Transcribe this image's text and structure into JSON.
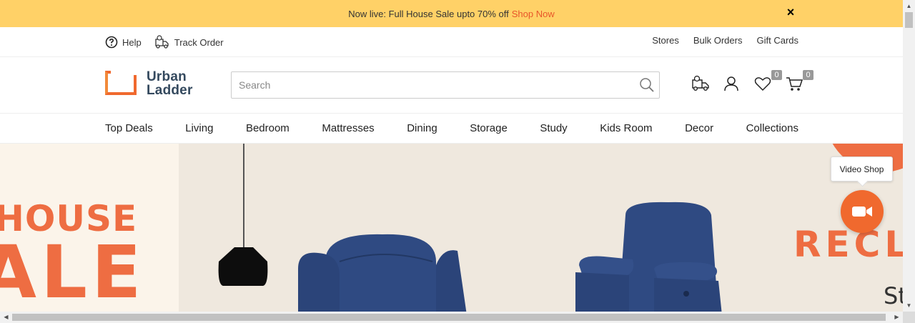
{
  "announcement": {
    "text": "Now live: Full House Sale upto 70% off",
    "link": "Shop Now",
    "close": "×"
  },
  "utility": {
    "help": "Help",
    "track_order": "Track Order",
    "stores": "Stores",
    "bulk_orders": "Bulk Orders",
    "gift_cards": "Gift Cards"
  },
  "header": {
    "logo_line1": "Urban",
    "logo_line2": "Ladder",
    "search_placeholder": "Search",
    "wishlist_count": "0",
    "cart_count": "0"
  },
  "nav": {
    "items": [
      "Top Deals",
      "Living",
      "Bedroom",
      "Mattresses",
      "Dining",
      "Storage",
      "Study",
      "Kids Room",
      "Decor",
      "Collections"
    ]
  },
  "hero": {
    "line1": "HOUSE",
    "line2": "ALE",
    "right_text": "RECL",
    "right_small": "St"
  },
  "video_shop": {
    "label": "Video Shop"
  },
  "colors": {
    "announcement_bg": "#ffd167",
    "accent": "#ee6d42",
    "logo_text": "#34495e"
  }
}
